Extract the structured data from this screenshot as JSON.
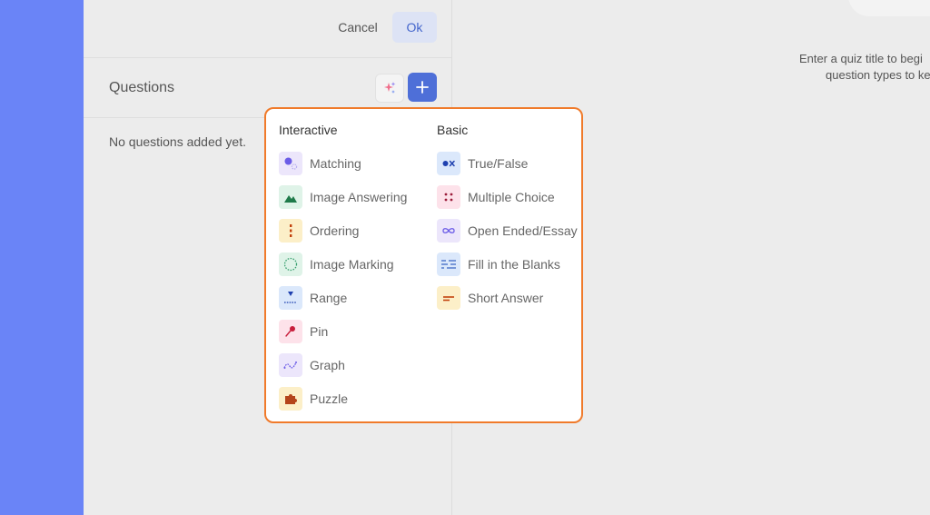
{
  "topbar": {
    "cancel_label": "Cancel",
    "ok_label": "Ok"
  },
  "questions": {
    "title": "Questions",
    "empty_text": "No questions added yet."
  },
  "hint": {
    "line1": "Enter a quiz title to begi",
    "line2": "question types to ke"
  },
  "menu": {
    "interactive_title": "Interactive",
    "basic_title": "Basic",
    "interactive": [
      {
        "label": "Matching",
        "icon": "matching-icon",
        "bg": "#ece6fb"
      },
      {
        "label": "Image Answering",
        "icon": "image-answering-icon",
        "bg": "#dff3e8"
      },
      {
        "label": "Ordering",
        "icon": "ordering-icon",
        "bg": "#fcefc8"
      },
      {
        "label": "Image Marking",
        "icon": "image-marking-icon",
        "bg": "#dff3e8"
      },
      {
        "label": "Range",
        "icon": "range-icon",
        "bg": "#dbe8fb"
      },
      {
        "label": "Pin",
        "icon": "pin-icon",
        "bg": "#fde2ea"
      },
      {
        "label": "Graph",
        "icon": "graph-icon",
        "bg": "#ece6fb"
      },
      {
        "label": "Puzzle",
        "icon": "puzzle-icon",
        "bg": "#fcefc8"
      }
    ],
    "basic": [
      {
        "label": "True/False",
        "icon": "true-false-icon",
        "bg": "#dbe8fb"
      },
      {
        "label": "Multiple Choice",
        "icon": "multiple-choice-icon",
        "bg": "#fde2ea"
      },
      {
        "label": "Open Ended/Essay",
        "icon": "open-ended-icon",
        "bg": "#ece6fb"
      },
      {
        "label": "Fill in the Blanks",
        "icon": "fill-blanks-icon",
        "bg": "#dbe8fb"
      },
      {
        "label": "Short Answer",
        "icon": "short-answer-icon",
        "bg": "#fcefc8"
      }
    ]
  },
  "colors": {
    "sidebar": "#6a84f7",
    "accent": "#4e6fd8",
    "menu_border": "#f07a2a"
  }
}
